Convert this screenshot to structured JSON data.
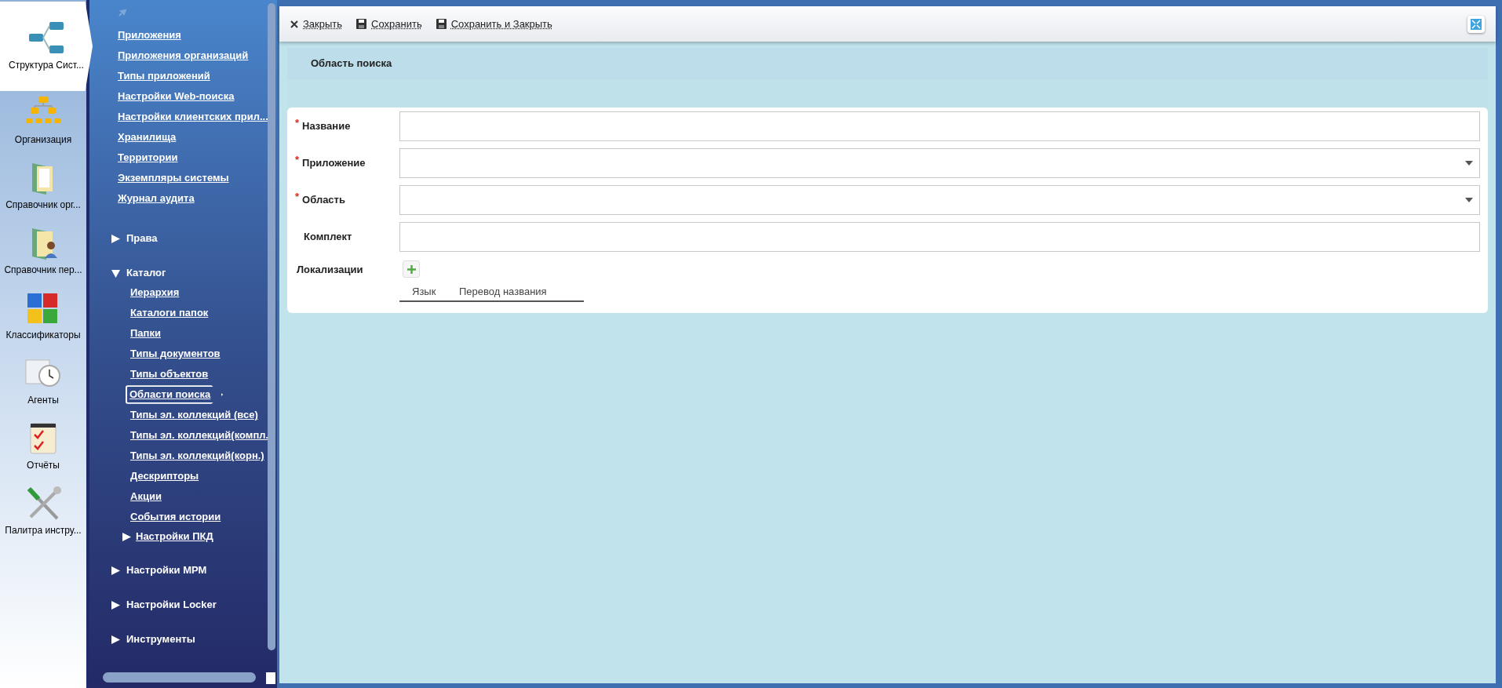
{
  "sidebar": {
    "items": [
      {
        "label": "Структура Сист...",
        "selected": true
      },
      {
        "label": "Организация",
        "selected": false
      },
      {
        "label": "Справочник орг...",
        "selected": false
      },
      {
        "label": "Справочник пер...",
        "selected": false
      },
      {
        "label": "Классификаторы",
        "selected": false
      },
      {
        "label": "Агенты",
        "selected": false
      },
      {
        "label": "Отчёты",
        "selected": false
      },
      {
        "label": "Палитра инстру...",
        "selected": false
      }
    ]
  },
  "nav": {
    "links": [
      {
        "label": "Приложения",
        "selected": false
      },
      {
        "label": "Приложения организаций",
        "selected": false
      },
      {
        "label": "Типы приложений",
        "selected": false
      },
      {
        "label": "Настройки Web-поиска",
        "selected": false
      },
      {
        "label": "Настройки клиентских прил...",
        "selected": false
      },
      {
        "label": "Хранилища",
        "selected": false
      },
      {
        "label": "Территории",
        "selected": false
      },
      {
        "label": "Экземпляры системы",
        "selected": false
      },
      {
        "label": "Журнал аудита",
        "selected": false
      }
    ],
    "sections": [
      {
        "label": "Права",
        "expanded": false
      },
      {
        "label": "Каталог",
        "expanded": true,
        "children": [
          {
            "kind": "link",
            "label": "Иерархия",
            "selected": false
          },
          {
            "kind": "link",
            "label": "Каталоги папок",
            "selected": false
          },
          {
            "kind": "link",
            "label": "Папки",
            "selected": false
          },
          {
            "kind": "link",
            "label": "Типы документов",
            "selected": false
          },
          {
            "kind": "link",
            "label": "Типы объектов",
            "selected": false
          },
          {
            "kind": "link",
            "label": "Области поиска",
            "selected": true
          },
          {
            "kind": "link",
            "label": "Типы эл. коллекций (все)",
            "selected": false
          },
          {
            "kind": "link",
            "label": "Типы эл. коллекций(компл.",
            "selected": false
          },
          {
            "kind": "link",
            "label": "Типы эл. коллекций(корн.)",
            "selected": false
          },
          {
            "kind": "link",
            "label": "Дескрипторы",
            "selected": false
          },
          {
            "kind": "link",
            "label": "Акции",
            "selected": false
          },
          {
            "kind": "link",
            "label": "События истории",
            "selected": false
          },
          {
            "kind": "section",
            "label": "Настройки ПКД",
            "expanded": false
          }
        ]
      },
      {
        "label": "Настройки МРМ",
        "expanded": false
      },
      {
        "label": "Настройки Locker",
        "expanded": false
      },
      {
        "label": "Инструменты",
        "expanded": false
      }
    ]
  },
  "toolbar": {
    "buttons": [
      {
        "kind": "close",
        "label": "Закрыть"
      },
      {
        "kind": "save",
        "label": "Сохранить"
      },
      {
        "kind": "save",
        "label": "Сохранить и Закрыть"
      }
    ]
  },
  "form": {
    "title": "Область поиска",
    "fields": [
      {
        "kind": "text",
        "label": "Название",
        "required_mark": "*"
      },
      {
        "kind": "select",
        "label": "Приложение",
        "required_mark": "*"
      },
      {
        "kind": "select",
        "label": "Область",
        "required_mark": "*"
      },
      {
        "kind": "text",
        "label": "Комплект"
      }
    ],
    "localizations": {
      "label": "Локализации",
      "columns": [
        "Язык",
        "Перевод названия"
      ]
    }
  }
}
